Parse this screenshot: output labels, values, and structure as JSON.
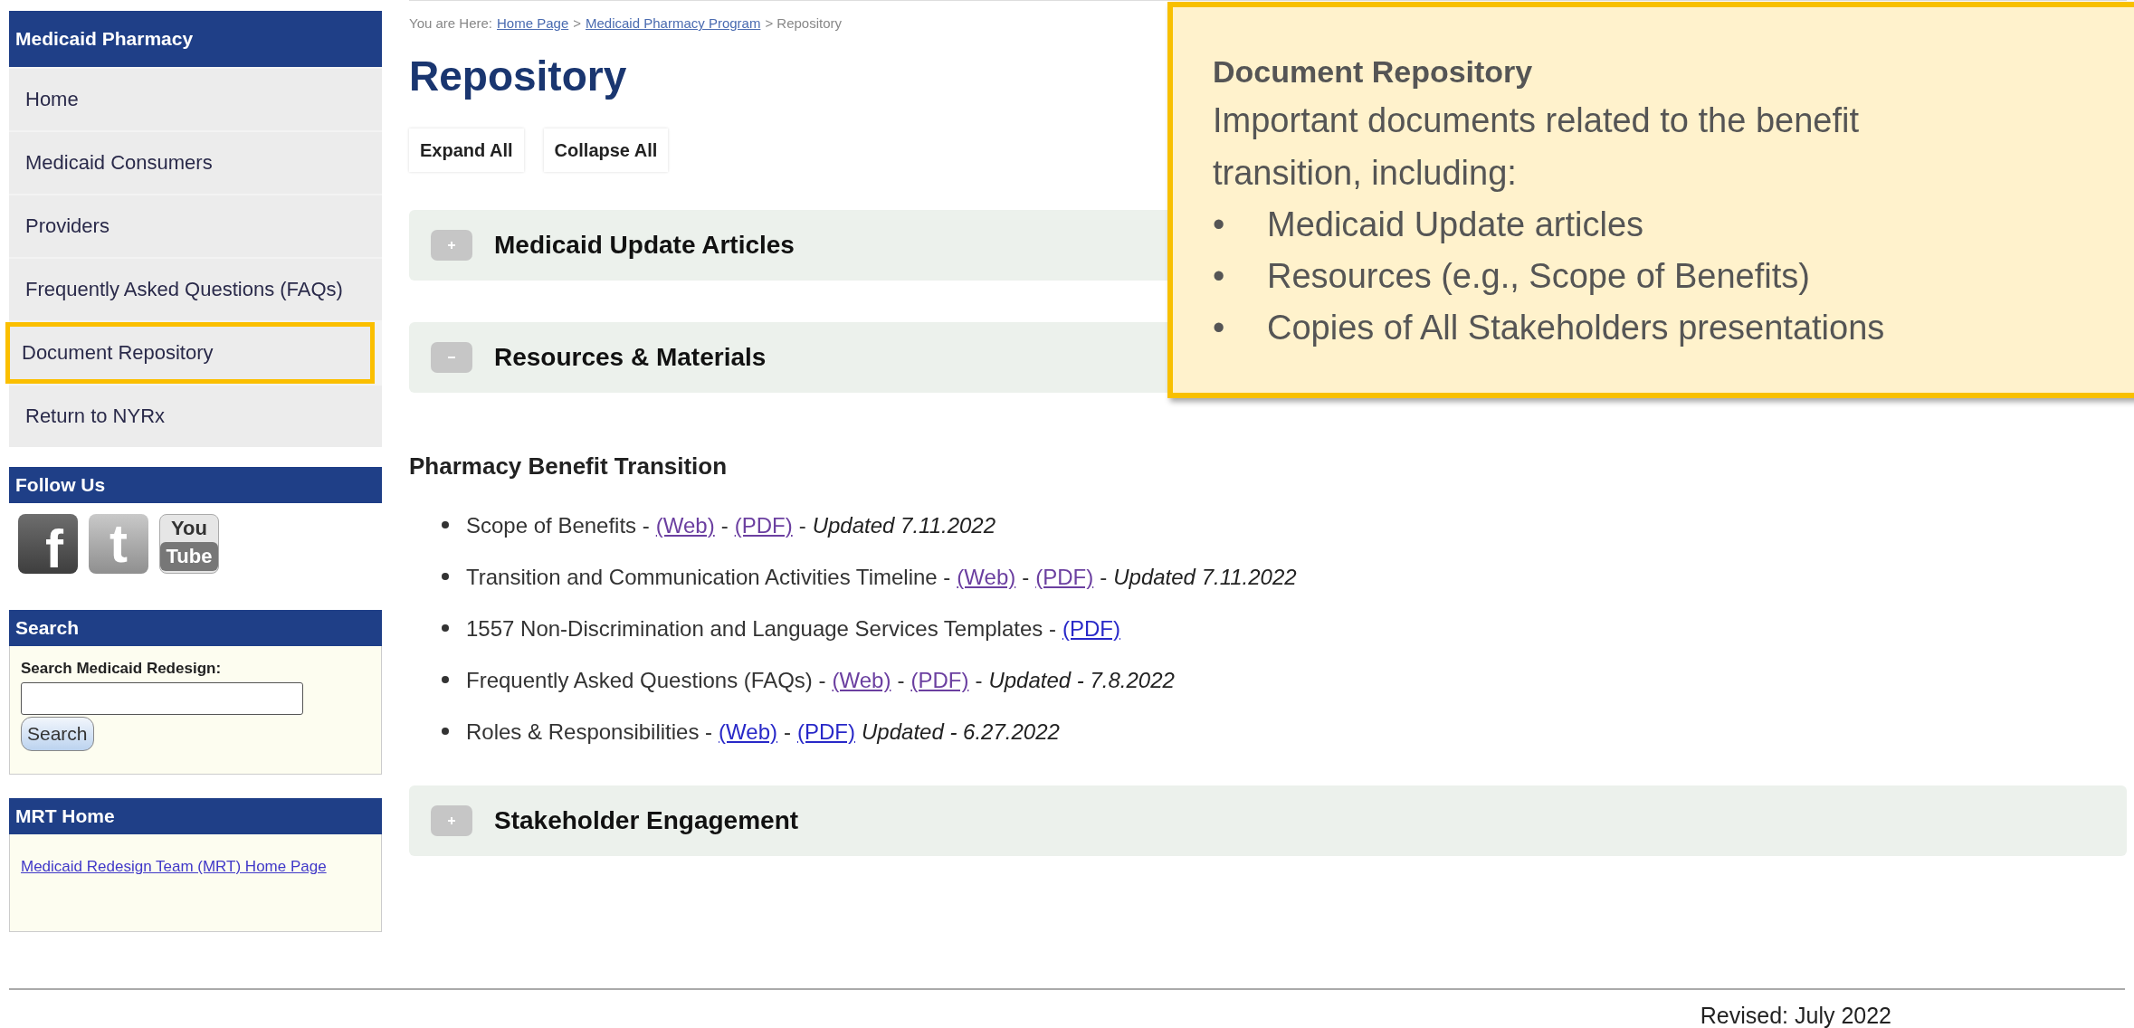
{
  "sidebar": {
    "title": "Medicaid Pharmacy",
    "items": [
      {
        "label": "Home",
        "highlighted": false
      },
      {
        "label": "Medicaid Consumers",
        "highlighted": false
      },
      {
        "label": "Providers",
        "highlighted": false
      },
      {
        "label": "Frequently Asked Questions (FAQs)",
        "highlighted": false
      },
      {
        "label": "Document Repository",
        "highlighted": true
      },
      {
        "label": "Return to NYRx",
        "highlighted": false
      }
    ],
    "follow_title": "Follow Us",
    "social": [
      {
        "kind": "facebook",
        "glyph": "f"
      },
      {
        "kind": "twitter",
        "glyph": "t"
      },
      {
        "kind": "youtube",
        "lines": [
          "You",
          "Tube"
        ]
      }
    ],
    "search_title": "Search",
    "search_label": "Search Medicaid Redesign:",
    "search_button": "Search",
    "mrt_title": "MRT Home",
    "mrt_link": "Medicaid Redesign Team (MRT) Home Page"
  },
  "breadcrumb": [
    {
      "kind": "text",
      "text": "You are Here:"
    },
    {
      "kind": "link",
      "text": "Home Page"
    },
    {
      "kind": "text",
      "text": ">"
    },
    {
      "kind": "link",
      "text": "Medicaid Pharmacy Program"
    },
    {
      "kind": "text",
      "text": "> Repository"
    }
  ],
  "title": "Repository",
  "buttons": [
    "Expand All",
    "Collapse All"
  ],
  "sections_top": [
    {
      "title": "Medicaid Update Articles",
      "expanded": false
    },
    {
      "title": "Resources & Materials",
      "expanded": true
    }
  ],
  "subheading": "Pharmacy Benefit Transition",
  "documents": [
    {
      "parts": [
        {
          "kind": "text",
          "text": "Scope of Benefits -"
        },
        {
          "kind": "link",
          "text": "(Web)",
          "visited": true
        },
        {
          "kind": "text",
          "text": "-"
        },
        {
          "kind": "link",
          "text": "(PDF)",
          "visited": true
        },
        {
          "kind": "text",
          "text": "-"
        },
        {
          "kind": "date",
          "text": "Updated 7.11.2022"
        }
      ]
    },
    {
      "parts": [
        {
          "kind": "text",
          "text": "Transition and Communication Activities Timeline -"
        },
        {
          "kind": "link",
          "text": "(Web)",
          "visited": true
        },
        {
          "kind": "text",
          "text": "-"
        },
        {
          "kind": "link",
          "text": "(PDF)",
          "visited": true
        },
        {
          "kind": "text",
          "text": "-"
        },
        {
          "kind": "date",
          "text": "Updated 7.11.2022"
        }
      ]
    },
    {
      "parts": [
        {
          "kind": "text",
          "text": "1557 Non-Discrimination and Language Services Templates -"
        },
        {
          "kind": "link",
          "text": "(PDF)",
          "visited": false
        }
      ]
    },
    {
      "parts": [
        {
          "kind": "text",
          "text": "Frequently Asked Questions (FAQs) -"
        },
        {
          "kind": "link",
          "text": "(Web)",
          "visited": true
        },
        {
          "kind": "text",
          "text": "-"
        },
        {
          "kind": "link",
          "text": "(PDF)",
          "visited": true
        },
        {
          "kind": "text",
          "text": "-"
        },
        {
          "kind": "date",
          "text": "Updated - 7.8.2022"
        }
      ]
    },
    {
      "parts": [
        {
          "kind": "text",
          "text": "Roles & Responsibilities -"
        },
        {
          "kind": "link",
          "text": "(Web)",
          "visited": false
        },
        {
          "kind": "text",
          "text": "-"
        },
        {
          "kind": "link",
          "text": "(PDF)",
          "visited": false
        },
        {
          "kind": "date",
          "text": "Updated - 6.27.2022"
        }
      ]
    }
  ],
  "sections_bottom": [
    {
      "title": "Stakeholder Engagement",
      "expanded": false
    }
  ],
  "footer": "Revised: July 2022",
  "callout": {
    "title": "Document Repository",
    "text": "Important documents related to the benefit transition, including:",
    "bullet": "•",
    "items": [
      "Medicaid Update articles",
      "Resources (e.g., Scope of Benefits)",
      "Copies of All Stakeholders presentations"
    ]
  }
}
